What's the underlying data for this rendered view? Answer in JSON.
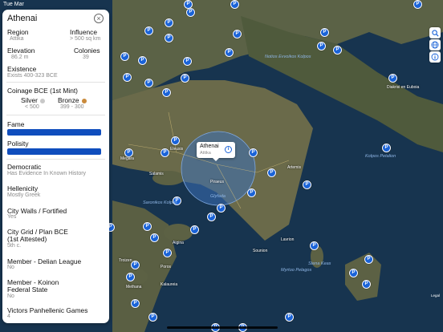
{
  "status_bar": {
    "left": "Tue Mar",
    "right": ""
  },
  "panel": {
    "title": "Athenai",
    "region_label": "Region",
    "region_value": "Attika",
    "influence_label": "Influence",
    "influence_value": "> 500 sq km",
    "elevation_label": "Elevation",
    "elevation_value": "86.2 m",
    "colonies_label": "Colonies",
    "colonies_value": "39",
    "existence_label": "Existence",
    "existence_value": "Exists 400-323 BCE",
    "coinage_label": "Coinage BCE (1st Mint)",
    "silver_label": "Silver",
    "silver_value": "< 500",
    "bronze_label": "Bronze",
    "bronze_value": "399 - 300",
    "fame_label": "Fame",
    "fame_level": 1.0,
    "polisity_label": "Polisity",
    "polisity_level": 1.0,
    "democratic_label": "Democratic",
    "democratic_value": "Has Evidence In Known History",
    "hellenicity_label": "Hellenicity",
    "hellenicity_value": "Mostly Greek",
    "walls_label": "City Walls / Fortified",
    "walls_value": "Yes",
    "grid_label_1": "City  Grid / Plan BCE",
    "grid_label_2": "(1st Attested)",
    "grid_value": "5th c.",
    "delian_label": "Member - Delian League",
    "delian_value": "No",
    "koinon_label_1": "Member - Koinon",
    "koinon_label_2": "Federal State",
    "koinon_value": "No",
    "victors_label": "Victors Panhellenic Games",
    "victors_value": "4"
  },
  "callout": {
    "name": "Athenai",
    "region": "Attika",
    "info_icon": "info-icon"
  },
  "map": {
    "pin_glyph": "P",
    "sea_labels": [
      "Notios Evvoikos Kolpos",
      "Saronikos Kolpos",
      "Kolpos Petalion",
      "Myrtoo Pelagos",
      "Stena Keas",
      "Glyfada"
    ],
    "place_labels": [
      "Diakrisi en Euboia",
      "Eleusis",
      "Megara",
      "Piraeus",
      "Artemis",
      "Lavrion",
      "Sounion",
      "Aigina",
      "Methana",
      "Troizen",
      "Poros",
      "Kalaureia",
      "Salamis"
    ]
  },
  "toolbar": {
    "search_icon": "search-icon",
    "layers_icon": "globe-icon",
    "info_icon": "info-icon"
  },
  "legal": "Legal",
  "colors": {
    "accent": "#1a63d8",
    "bar": "#0f4dbd",
    "silver": "#c8c8c8",
    "bronze": "#c98a3c",
    "sea": "#1b3a55"
  }
}
